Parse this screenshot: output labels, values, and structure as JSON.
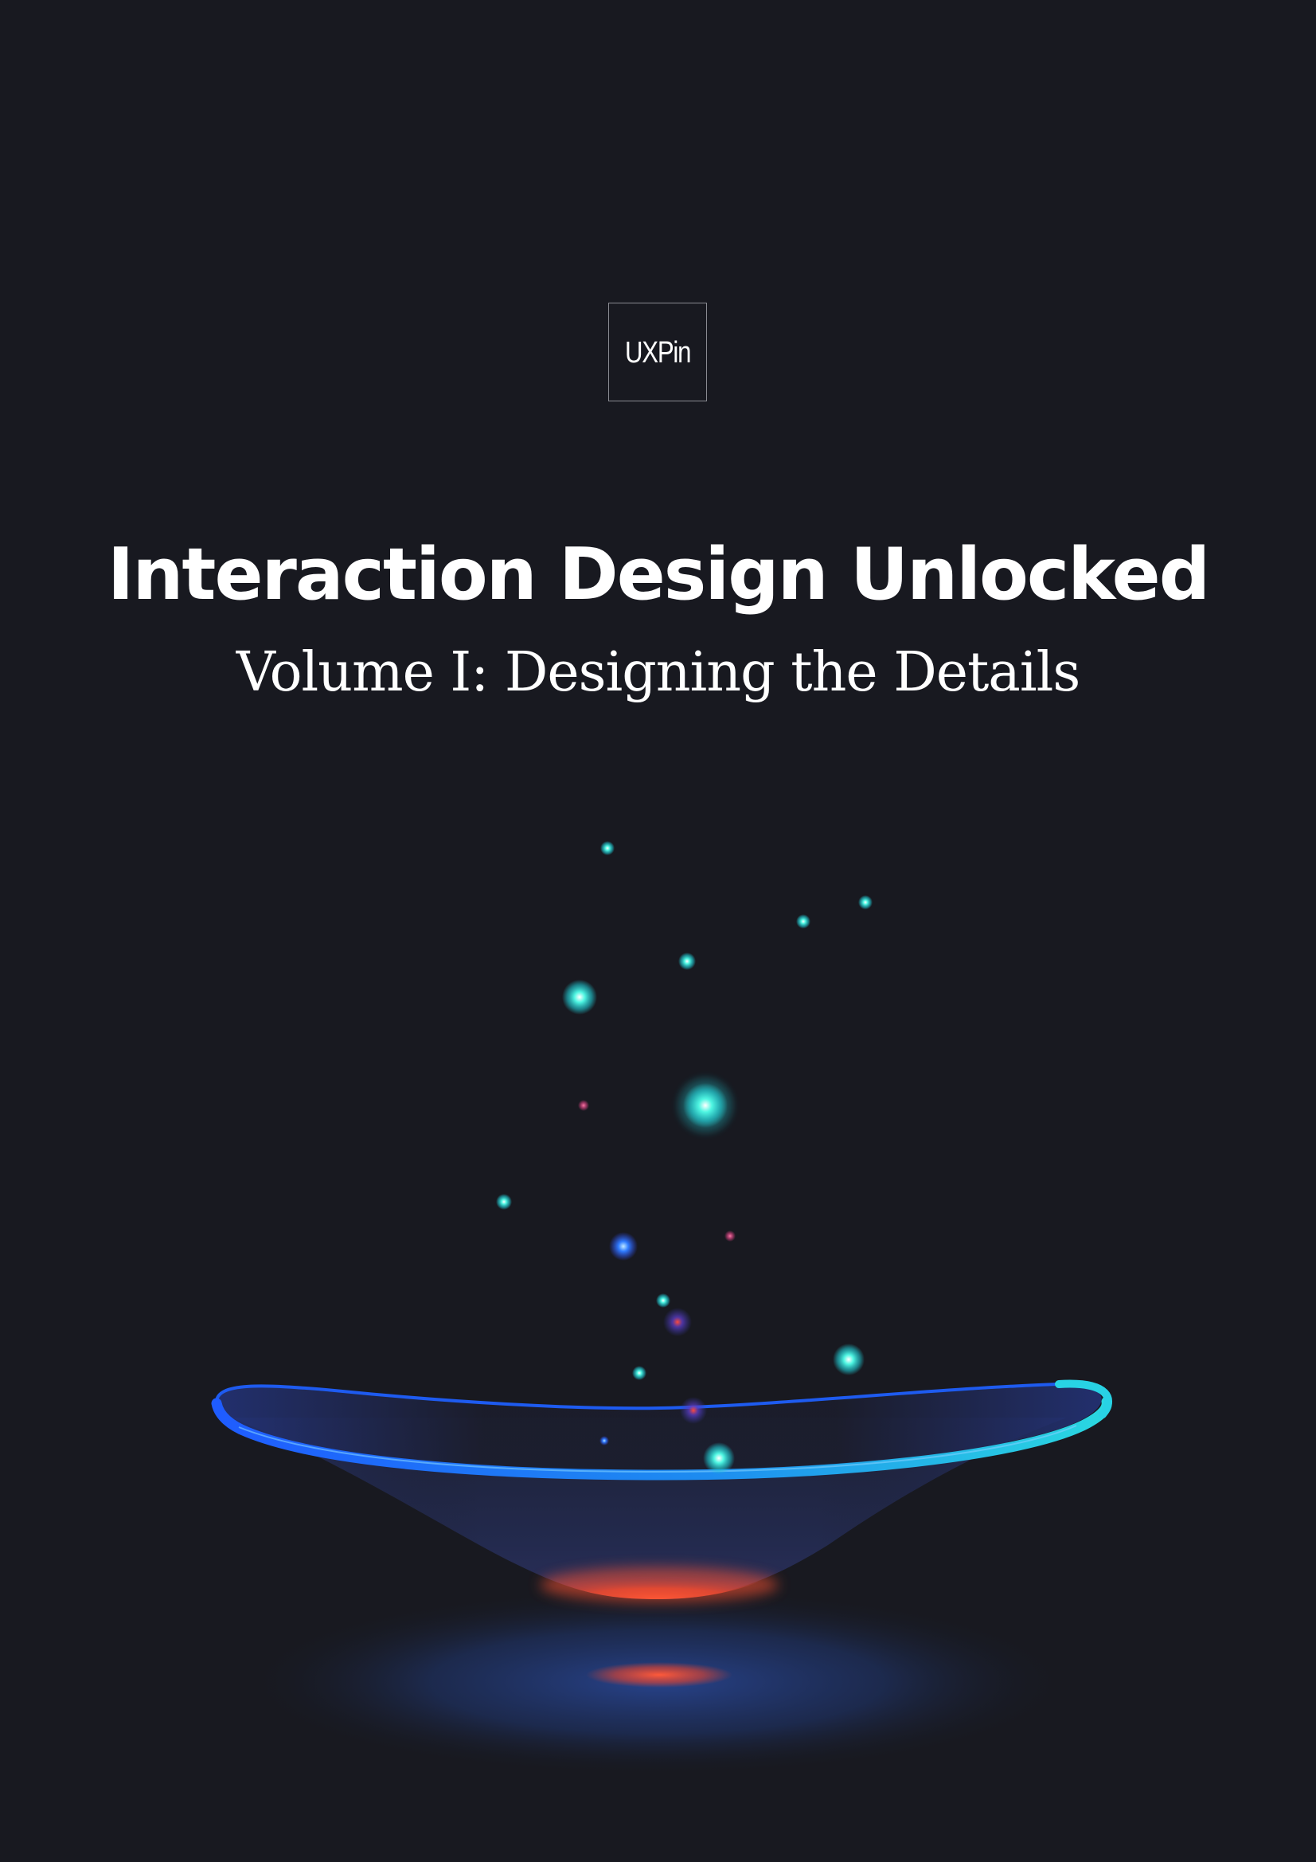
{
  "logo": {
    "text": "UXPin"
  },
  "cover": {
    "title": "Interaction Design Unlocked",
    "subtitle": "Volume I: Designing the Details"
  },
  "illustration": {
    "name": "glowing-bowl-with-particles",
    "colors": {
      "background": "#181920",
      "rim_blue": "#1f66ff",
      "rim_cyan": "#23d6e6",
      "glow_red": "#ff4a2e",
      "particle_cyan": "#39f0d8",
      "particle_pink": "#e0508a"
    }
  }
}
